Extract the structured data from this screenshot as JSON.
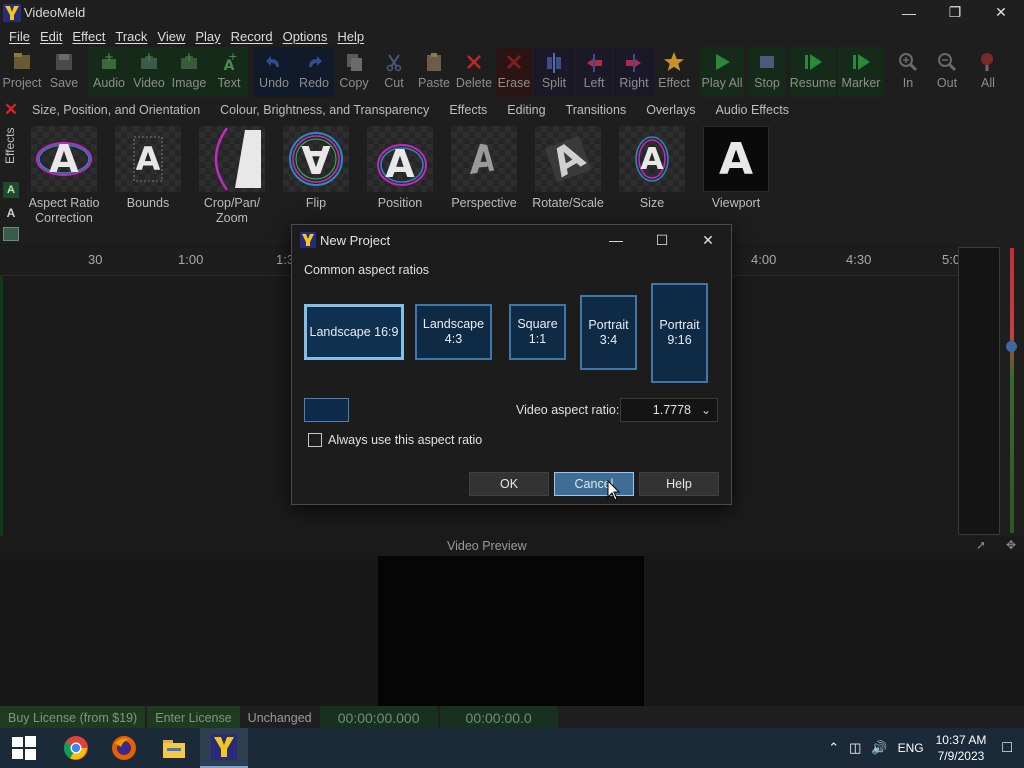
{
  "window": {
    "title": "VideoMeld",
    "controls": [
      "minimize",
      "restore",
      "close"
    ]
  },
  "menu": [
    "File",
    "Edit",
    "Effect",
    "Track",
    "View",
    "Play",
    "Record",
    "Options",
    "Help"
  ],
  "toolbar": [
    {
      "label": "Project",
      "icon": "project-icon",
      "group": "none"
    },
    {
      "label": "Save",
      "icon": "save-icon",
      "group": "none"
    },
    {
      "label": "Audio",
      "icon": "audio-add-icon",
      "group": "green"
    },
    {
      "label": "Video",
      "icon": "video-add-icon",
      "group": "green"
    },
    {
      "label": "Image",
      "icon": "image-add-icon",
      "group": "green"
    },
    {
      "label": "Text",
      "icon": "text-add-icon",
      "group": "green"
    },
    {
      "label": "Undo",
      "icon": "undo-icon",
      "group": "blue"
    },
    {
      "label": "Redo",
      "icon": "redo-icon",
      "group": "blue"
    },
    {
      "label": "Copy",
      "icon": "copy-icon",
      "group": "none"
    },
    {
      "label": "Cut",
      "icon": "cut-icon",
      "group": "none"
    },
    {
      "label": "Paste",
      "icon": "paste-icon",
      "group": "none"
    },
    {
      "label": "Delete",
      "icon": "delete-icon",
      "group": "none"
    },
    {
      "label": "Erase",
      "icon": "erase-icon",
      "group": "red"
    },
    {
      "label": "Split",
      "icon": "split-icon",
      "group": "purple"
    },
    {
      "label": "Left",
      "icon": "left-icon",
      "group": "purple"
    },
    {
      "label": "Right",
      "icon": "right-icon",
      "group": "purple"
    },
    {
      "label": "Effect",
      "icon": "effect-star-icon",
      "group": "none"
    },
    {
      "label": "Play All",
      "icon": "play-all-icon",
      "group": "green"
    },
    {
      "label": "Stop",
      "icon": "stop-icon",
      "group": "green"
    },
    {
      "label": "Resume",
      "icon": "resume-icon",
      "group": "green"
    },
    {
      "label": "Marker",
      "icon": "marker-icon",
      "group": "green"
    },
    {
      "label": "In",
      "icon": "zoom-in-icon",
      "group": "none"
    },
    {
      "label": "Out",
      "icon": "zoom-out-icon",
      "group": "none"
    },
    {
      "label": "All",
      "icon": "zoom-all-icon",
      "group": "none"
    }
  ],
  "effect_tabs": [
    "Size, Position, and Orientation",
    "Colour, Brightness, and Transparency",
    "Effects",
    "Editing",
    "Transitions",
    "Overlays",
    "Audio Effects"
  ],
  "side_label": "Effects",
  "effects": [
    {
      "label": "Aspect Ratio Correction",
      "icon": "aspect-ratio-correction-icon"
    },
    {
      "label": "Bounds",
      "icon": "bounds-icon"
    },
    {
      "label": "Crop/Pan/ Zoom",
      "icon": "crop-pan-zoom-icon"
    },
    {
      "label": "Flip",
      "icon": "flip-icon"
    },
    {
      "label": "Position",
      "icon": "position-icon"
    },
    {
      "label": "Perspective",
      "icon": "perspective-icon"
    },
    {
      "label": "Rotate/Scale",
      "icon": "rotate-scale-icon"
    },
    {
      "label": "Size",
      "icon": "size-icon"
    },
    {
      "label": "Viewport",
      "icon": "viewport-icon"
    }
  ],
  "ruler": [
    "30",
    "1:00",
    "1:3",
    "4:00",
    "4:30",
    "5:0"
  ],
  "preview": {
    "label": "Video Preview"
  },
  "status": {
    "buy": "Buy License (from $19)",
    "enter": "Enter License",
    "state": "Unchanged",
    "timecode": "00:00:00.000",
    "duration": "00:00:00.0"
  },
  "dialog": {
    "title": "New Project",
    "section": "Common aspect ratios",
    "ratios": [
      {
        "line1": "Landscape 16:9",
        "line2": "",
        "selected": true
      },
      {
        "line1": "Landscape",
        "line2": "4:3",
        "selected": false
      },
      {
        "line1": "Square",
        "line2": "1:1",
        "selected": false
      },
      {
        "line1": "Portrait",
        "line2": "3:4",
        "selected": false
      },
      {
        "line1": "Portrait",
        "line2": "9:16",
        "selected": false
      }
    ],
    "ratio_label": "Video aspect ratio:",
    "ratio_value": "1.7778",
    "checkbox_label": "Always use this aspect ratio",
    "checkbox_checked": false,
    "buttons": {
      "ok": "OK",
      "cancel": "Cancel",
      "help": "Help"
    }
  },
  "taskbar": {
    "apps": [
      "start-icon",
      "chrome-icon",
      "firefox-icon",
      "file-explorer-icon",
      "videomeld-icon"
    ],
    "language": "ENG",
    "time": "10:37 AM",
    "date": "7/9/2023"
  },
  "colors": {
    "accent": "#3f78a8",
    "selected_border": "#86bfe6",
    "background": "#1e1e1e"
  }
}
